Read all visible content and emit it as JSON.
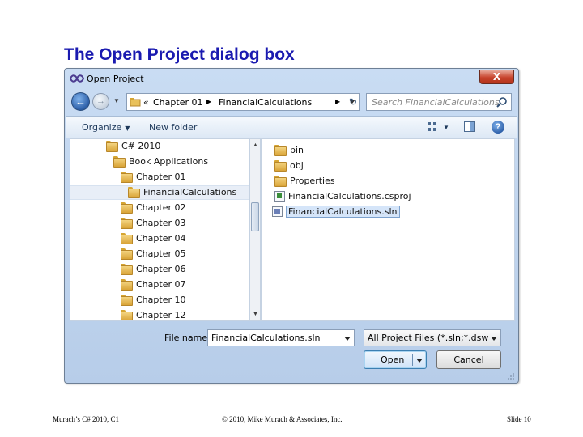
{
  "slide": {
    "title": "The Open Project dialog box",
    "footer_left": "Murach’s C# 2010, C1",
    "footer_center": "© 2010, Mike Murach & Associates, Inc.",
    "footer_right": "Slide 10"
  },
  "dialog": {
    "title": "Open Project",
    "close_label": "X",
    "address": {
      "prefix": "«",
      "parts": [
        "Chapter 01",
        "FinancialCalculations"
      ]
    },
    "search_placeholder": "Search FinancialCalculations",
    "toolbar": {
      "organize_label": "Organize",
      "new_folder_label": "New folder"
    },
    "tree": [
      {
        "label": "C# 2010",
        "depth": 0,
        "selected": false
      },
      {
        "label": "Book Applications",
        "depth": 1,
        "selected": false
      },
      {
        "label": "Chapter 01",
        "depth": 2,
        "selected": false
      },
      {
        "label": "FinancialCalculations",
        "depth": 3,
        "selected": true
      },
      {
        "label": "Chapter 02",
        "depth": 2,
        "selected": false
      },
      {
        "label": "Chapter 03",
        "depth": 2,
        "selected": false
      },
      {
        "label": "Chapter 04",
        "depth": 2,
        "selected": false
      },
      {
        "label": "Chapter 05",
        "depth": 2,
        "selected": false
      },
      {
        "label": "Chapter 06",
        "depth": 2,
        "selected": false
      },
      {
        "label": "Chapter 07",
        "depth": 2,
        "selected": false
      },
      {
        "label": "Chapter 10",
        "depth": 2,
        "selected": false
      },
      {
        "label": "Chapter 12",
        "depth": 2,
        "selected": false
      }
    ],
    "files": [
      {
        "label": "bin",
        "type": "folder",
        "selected": false
      },
      {
        "label": "obj",
        "type": "folder",
        "selected": false
      },
      {
        "label": "Properties",
        "type": "folder",
        "selected": false
      },
      {
        "label": "FinancialCalculations.csproj",
        "type": "project",
        "selected": false
      },
      {
        "label": "FinancialCalculations.sln",
        "type": "solution",
        "selected": true
      }
    ],
    "file_name_label": "File name:",
    "file_name_value": "FinancialCalculations.sln",
    "filter_value": "All Project Files (*.sln;*.dsw;*.vc",
    "open_label": "Open",
    "cancel_label": "Cancel"
  }
}
